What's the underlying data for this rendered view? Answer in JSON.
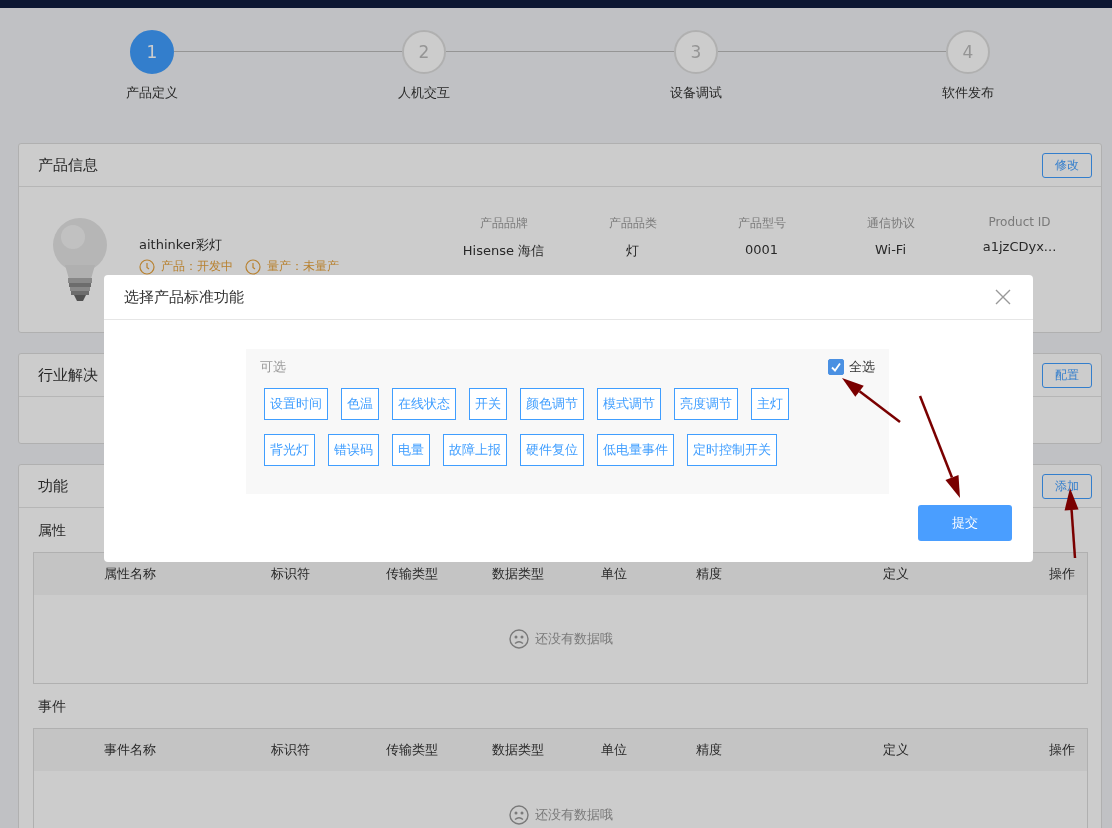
{
  "steps": [
    {
      "number": "1",
      "label": "产品定义",
      "selected": true
    },
    {
      "number": "2",
      "label": "人机交互",
      "selected": false
    },
    {
      "number": "3",
      "label": "设备调试",
      "selected": false
    },
    {
      "number": "4",
      "label": "软件发布",
      "selected": false
    }
  ],
  "product_info": {
    "title": "产品信息",
    "edit_button": "修改",
    "name": "aithinker彩灯",
    "statuses": [
      {
        "label": "产品：开发中"
      },
      {
        "label": "量产：未量产"
      }
    ],
    "fields": [
      {
        "label": "产品品牌",
        "value": "Hisense 海信"
      },
      {
        "label": "产品品类",
        "value": "灯"
      },
      {
        "label": "产品型号",
        "value": "0001"
      },
      {
        "label": "通信协议",
        "value": "Wi-Fi"
      },
      {
        "label": "Product ID",
        "value": "a1jzCDyx..."
      }
    ]
  },
  "industry": {
    "title": "行业解决",
    "button": "配置"
  },
  "functions": {
    "title": "功能",
    "button": "添加",
    "sections": [
      {
        "title": "属性",
        "columns": [
          "属性名称",
          "标识符",
          "传输类型",
          "数据类型",
          "单位",
          "精度",
          "定义",
          "操作"
        ],
        "empty_text": "还没有数据哦"
      },
      {
        "title": "事件",
        "columns": [
          "事件名称",
          "标识符",
          "传输类型",
          "数据类型",
          "单位",
          "精度",
          "定义",
          "操作"
        ],
        "empty_text": "还没有数据哦"
      }
    ]
  },
  "dialog": {
    "title": "选择产品标准功能",
    "panel_label": "可选",
    "select_all": {
      "label": "全选",
      "checked": true
    },
    "tags": [
      [
        "设置时间",
        "色温",
        "在线状态",
        "开关",
        "颜色调节",
        "模式调节",
        "亮度调节",
        "主灯"
      ],
      [
        "背光灯",
        "错误码",
        "电量",
        "故障上报",
        "硬件复位",
        "低电量事件",
        "定时控制开关"
      ]
    ],
    "submit": "提交"
  }
}
